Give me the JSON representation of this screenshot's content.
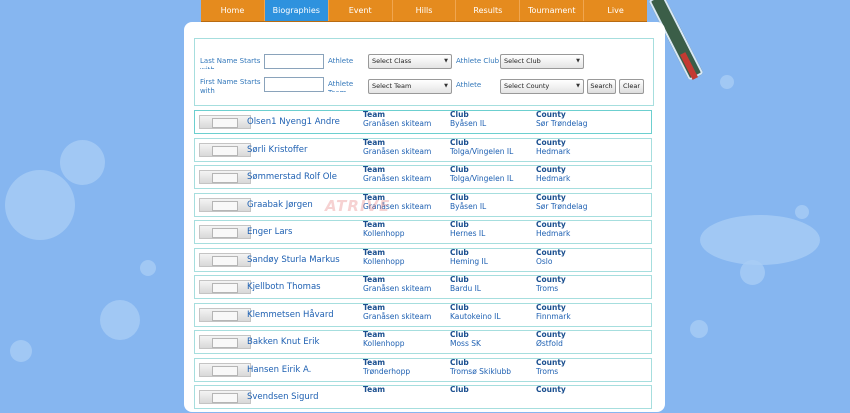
{
  "nav": [
    "Home",
    "Biographies",
    "Event",
    "Hills",
    "Results",
    "Tournament",
    "Live"
  ],
  "active_nav": "Biographies",
  "filters": {
    "last_name_label": "Last Name Starts with",
    "first_name_label": "First Name Starts with",
    "athlete_label": "Athlete",
    "athlete_team_label": "Athlete Team",
    "athlete_club_label": "Athlete Club",
    "athlete_label2": "Athlete",
    "select_class": "Select Class",
    "select_team": "Select Team",
    "select_club": "Select Club",
    "select_county": "Select County",
    "search": "Search",
    "clear": "Clear"
  },
  "col_labels": {
    "team": "Team",
    "club": "Club",
    "county": "County"
  },
  "watermark": "ATRIVE",
  "athletes": [
    {
      "name": "Olsen1 Nyeng1 Andre",
      "team": "Granåsen skiteam",
      "club": "Byåsen IL",
      "county": "Sør Trøndelag"
    },
    {
      "name": "Sørli Kristoffer",
      "team": "Granåsen skiteam",
      "club": "Tolga/Vingelen IL",
      "county": "Hedmark"
    },
    {
      "name": "Sømmerstad Rolf Ole",
      "team": "Granåsen skiteam",
      "club": "Tolga/Vingelen IL",
      "county": "Hedmark"
    },
    {
      "name": "Graabak Jørgen",
      "team": "Granåsen skiteam",
      "club": "Byåsen IL",
      "county": "Sør Trøndelag"
    },
    {
      "name": "Enger Lars",
      "team": "Kollenhopp",
      "club": "Hernes IL",
      "county": "Hedmark"
    },
    {
      "name": "Sandøy Sturla Markus",
      "team": "Kollenhopp",
      "club": "Heming IL",
      "county": "Oslo"
    },
    {
      "name": "Kjellbotn Thomas",
      "team": "Granåsen skiteam",
      "club": "Bardu IL",
      "county": "Troms"
    },
    {
      "name": "Klemmetsen Håvard",
      "team": "Granåsen skiteam",
      "club": "Kautokeino IL",
      "county": "Finnmark"
    },
    {
      "name": "Bakken Knut Erik",
      "team": "Kollenhopp",
      "club": "Moss SK",
      "county": "Østfold"
    },
    {
      "name": "Hansen Eirik A.",
      "team": "Trønderhopp",
      "club": "Tromsø Skiklubb",
      "county": "Troms"
    },
    {
      "name": "Svendsen Sigurd",
      "team": "",
      "club": "",
      "county": ""
    }
  ]
}
